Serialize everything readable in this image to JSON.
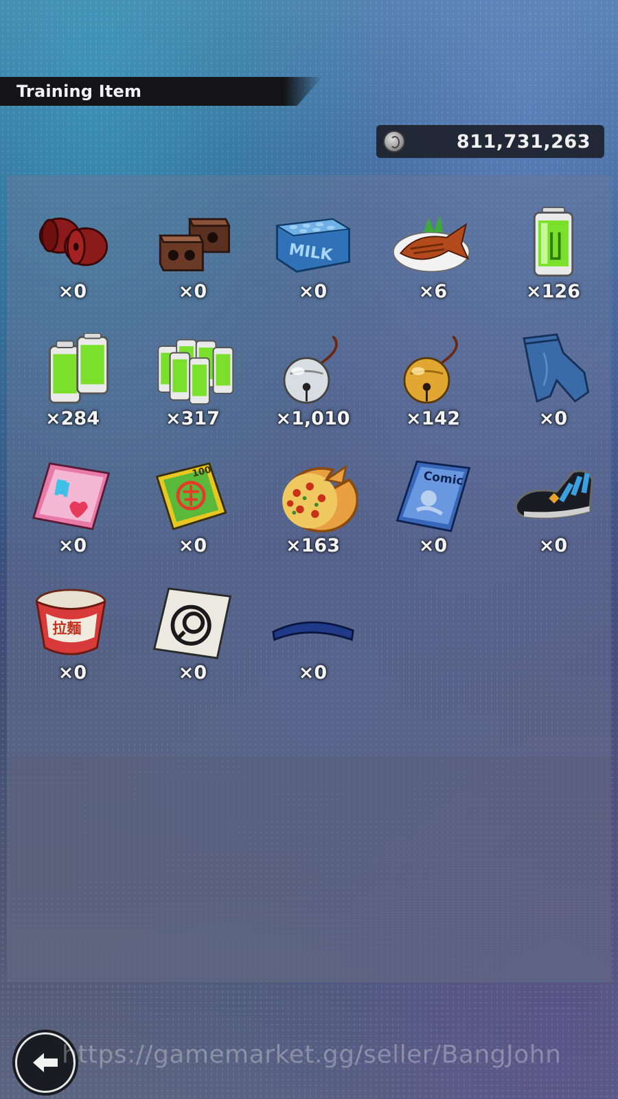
{
  "header": {
    "title": "Training Item"
  },
  "currency": {
    "icon": "zeni-coin-icon",
    "value": "811,731,263"
  },
  "items": [
    {
      "name": "red-weights-icon",
      "count": "×0"
    },
    {
      "name": "brown-weights-icon",
      "count": "×0"
    },
    {
      "name": "milk-carton-icon",
      "count": "×0"
    },
    {
      "name": "grilled-fish-icon",
      "count": "×6"
    },
    {
      "name": "battery-icon",
      "count": "×126"
    },
    {
      "name": "double-battery-icon",
      "count": "×284"
    },
    {
      "name": "battery-pack-icon",
      "count": "×317"
    },
    {
      "name": "silver-bell-icon",
      "count": "×1,010"
    },
    {
      "name": "gold-bell-icon",
      "count": "×142"
    },
    {
      "name": "jeans-icon",
      "count": "×0"
    },
    {
      "name": "pink-magazine-icon",
      "count": "×0"
    },
    {
      "name": "manga-book-icon",
      "count": "×0"
    },
    {
      "name": "pizza-icon",
      "count": "×163"
    },
    {
      "name": "comic-magazine-icon",
      "count": "×0"
    },
    {
      "name": "sneaker-icon",
      "count": "×0"
    },
    {
      "name": "cup-noodle-icon",
      "count": "×0"
    },
    {
      "name": "emblem-card-icon",
      "count": "×0"
    },
    {
      "name": "blue-headband-icon",
      "count": "×0"
    }
  ],
  "footer": {
    "back_icon": "back-arrow-icon"
  },
  "watermark": "https://gamemarket.gg/seller/BangJohn"
}
